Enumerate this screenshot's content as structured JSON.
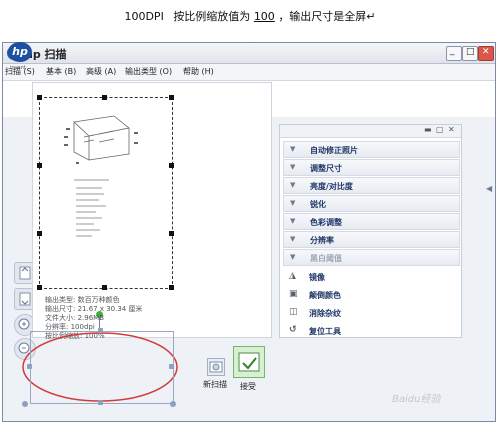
{
  "caption": {
    "prefix": "100DPI",
    "middle": "按比例缩放值为",
    "value": "100",
    "suffix": "，输出尺寸是全屏↵"
  },
  "window": {
    "title": "hp 扫描",
    "min": "_",
    "max": "□",
    "close": "✕"
  },
  "menu": [
    "扫描 (S)",
    "基本 (B)",
    "高级 (A)",
    "输出类型 (O)",
    "帮助 (H)"
  ],
  "logo": {
    "mark": "hp",
    "text": "invent"
  },
  "scan_info": [
    "输出类型: 数百万种颜色",
    "输出尺寸: 21.67 x 30.34 厘米",
    "文件大小: 2.96MB",
    "分辨率: 100dpi",
    "按比例缩放: 100%"
  ],
  "buttons": {
    "new_scan": "新扫描",
    "accept": "接受"
  },
  "right_menu": [
    {
      "label": "自动修正照片",
      "enabled": true
    },
    {
      "label": "调整尺寸",
      "enabled": true
    },
    {
      "label": "亮度/对比度",
      "enabled": true
    },
    {
      "label": "锐化",
      "enabled": true
    },
    {
      "label": "色彩调整",
      "enabled": true
    },
    {
      "label": "分辨率",
      "enabled": true
    },
    {
      "label": "黑白阈值",
      "enabled": false
    }
  ],
  "tools": [
    {
      "label": "镜像",
      "icon": "mirror-icon"
    },
    {
      "label": "颠倒颜色",
      "icon": "invert-icon"
    },
    {
      "label": "消除杂纹",
      "icon": "descreen-icon"
    },
    {
      "label": "复位工具",
      "icon": "reset-icon"
    }
  ],
  "watermark": "Baidu经验"
}
